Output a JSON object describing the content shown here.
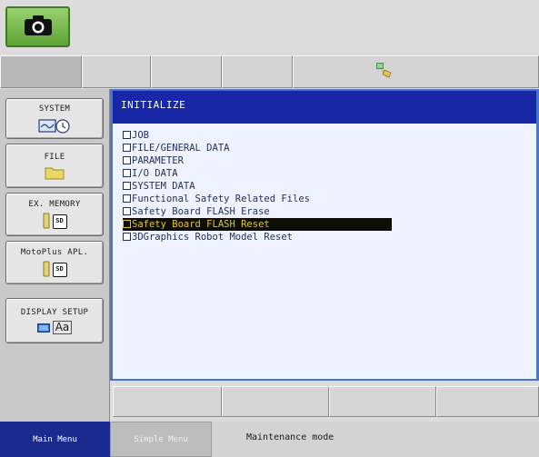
{
  "top": {
    "camera_icon": "camera-icon"
  },
  "tab_row": {
    "status_icon": "robot-tool-status-icon"
  },
  "left_menu": [
    {
      "label": "SYSTEM",
      "icon": "system-clock-icon"
    },
    {
      "label": "FILE",
      "icon": "folder-icon"
    },
    {
      "label": "EX. MEMORY",
      "icon": "sd-card-icon"
    },
    {
      "label": "MotoPlus APL.",
      "icon": "sd-card-icon"
    },
    {
      "label": "DISPLAY SETUP",
      "icon": "display-font-icon",
      "icon_text": "Aa"
    }
  ],
  "main": {
    "title": "INITIALIZE",
    "items": [
      {
        "label": "JOB",
        "checked": false,
        "selected": false
      },
      {
        "label": "FILE/GENERAL DATA",
        "checked": false,
        "selected": false
      },
      {
        "label": "PARAMETER",
        "checked": false,
        "selected": false
      },
      {
        "label": "I/O DATA",
        "checked": false,
        "selected": false
      },
      {
        "label": "SYSTEM DATA",
        "checked": false,
        "selected": false
      },
      {
        "label": "Functional Safety Related Files",
        "checked": false,
        "selected": false
      },
      {
        "label": "Safety Board FLASH Erase",
        "checked": false,
        "selected": false
      },
      {
        "label": "Safety Board FLASH Reset",
        "checked": false,
        "selected": true
      },
      {
        "label": "3DGraphics Robot Model Reset",
        "checked": false,
        "selected": false
      }
    ]
  },
  "status_bar": {
    "main_menu": "Main Menu",
    "simple_menu": "Simple Menu",
    "mode": "Maintenance mode"
  },
  "icon_text": {
    "sd": "SD"
  },
  "colors": {
    "title_bar": "#1727a5",
    "content_bg": "#eef3ff",
    "selected_bg": "#0d0d06",
    "selected_text": "#e6c81e",
    "main_menu_bg": "#1a2a8e",
    "camera_button": "#6fb443"
  }
}
